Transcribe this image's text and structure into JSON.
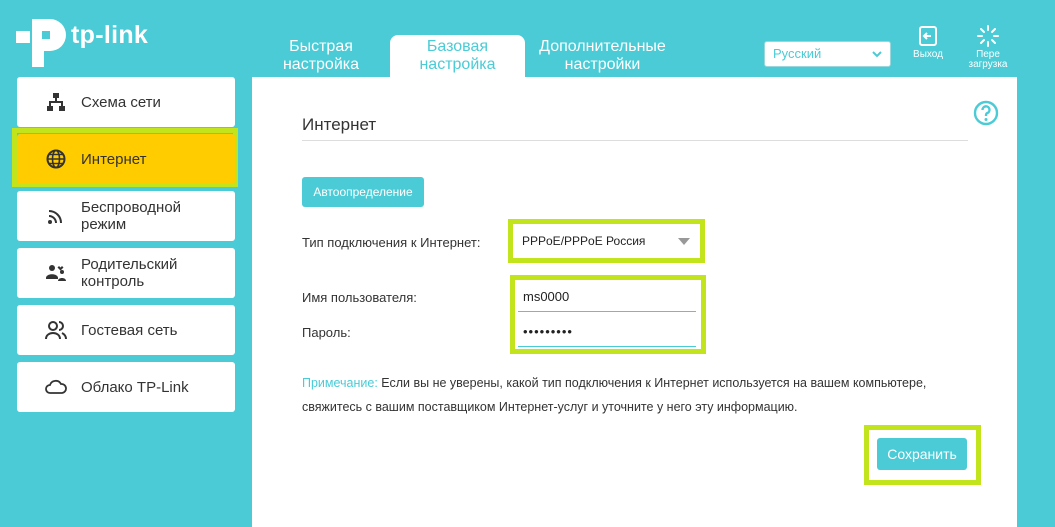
{
  "brand": {
    "name": "tp-link"
  },
  "tabs": [
    {
      "line1": "Быстрая",
      "line2": "настройка",
      "active": false
    },
    {
      "line1": "Базовая",
      "line2": "настройка",
      "active": true
    },
    {
      "line1": "Дополнительные",
      "line2": "настройки",
      "active": false
    }
  ],
  "language": {
    "selected": "Русский"
  },
  "header_buttons": {
    "logout": "Выход",
    "reboot_line1": "Пере",
    "reboot_line2": "загрузка"
  },
  "sidebar": {
    "items": [
      {
        "label": "Схема сети",
        "icon": "network-map-icon"
      },
      {
        "label": "Интернет",
        "icon": "globe-icon",
        "active": true
      },
      {
        "label": "Беспроводной режим",
        "icon": "wireless-icon"
      },
      {
        "label": "Родительский контроль",
        "icon": "parental-control-icon"
      },
      {
        "label": "Гостевая сеть",
        "icon": "guest-network-icon"
      },
      {
        "label": "Облако TP-Link",
        "icon": "cloud-icon"
      }
    ]
  },
  "main": {
    "title": "Интернет",
    "auto_detect_label": "Автоопределение",
    "connection_type_label": "Тип подключения к Интернет:",
    "connection_type_value": "PPPoE/PPPoE Россия",
    "username_label": "Имя пользователя:",
    "username_value": "ms0000",
    "password_label": "Пароль:",
    "password_value": "•••••••••",
    "note_label": "Примечание:",
    "note_text": " Если вы не уверены, какой тип подключения к Интернет используется на вашем компьютере, свяжитесь с вашим поставщиком Интернет-услуг и уточните у него эту информацию.",
    "save_label": "Сохранить"
  },
  "colors": {
    "accent": "#4acbd6",
    "active_sidebar": "#ffcc00",
    "highlight": "#c2e41c"
  }
}
